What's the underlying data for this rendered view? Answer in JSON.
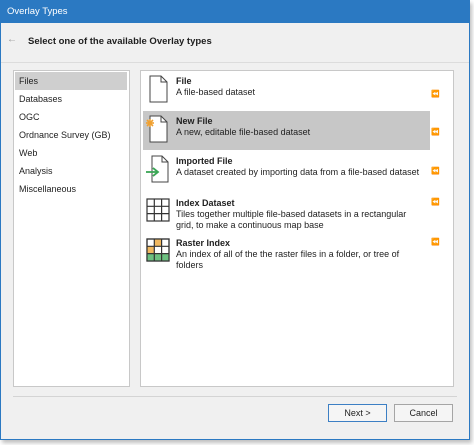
{
  "window": {
    "title": "Overlay Types"
  },
  "header": {
    "instruction": "Select one of the available Overlay types"
  },
  "sidebar": {
    "items": [
      {
        "label": "Files",
        "selected": true
      },
      {
        "label": "Databases",
        "selected": false
      },
      {
        "label": "OGC",
        "selected": false
      },
      {
        "label": "Ordnance Survey (GB)",
        "selected": false
      },
      {
        "label": "Web",
        "selected": false
      },
      {
        "label": "Analysis",
        "selected": false
      },
      {
        "label": "Miscellaneous",
        "selected": false
      }
    ]
  },
  "overlays": [
    {
      "title": "File",
      "description": "A file-based dataset",
      "icon": "file-icon",
      "selected": false
    },
    {
      "title": "New File",
      "description": "A new, editable file-based dataset",
      "icon": "new-file-icon",
      "selected": true
    },
    {
      "title": "Imported File",
      "description": "A dataset created by importing data from a file-based dataset",
      "icon": "imported-file-icon",
      "selected": false
    },
    {
      "title": "Index Dataset",
      "description": "Tiles together multiple file-based datasets in a rectangular grid, to make a continuous map base",
      "icon": "grid-icon",
      "selected": false
    },
    {
      "title": "Raster Index",
      "description": "An index of all of the the raster files in a folder, or tree of folders",
      "icon": "raster-grid-icon",
      "selected": false
    }
  ],
  "buttons": {
    "next": "Next >",
    "cancel": "Cancel"
  },
  "colors": {
    "titlebar": "#2b79c2",
    "selection": "#c7c7c7",
    "accent_green": "#3aa655",
    "accent_orange": "#f0a030"
  }
}
